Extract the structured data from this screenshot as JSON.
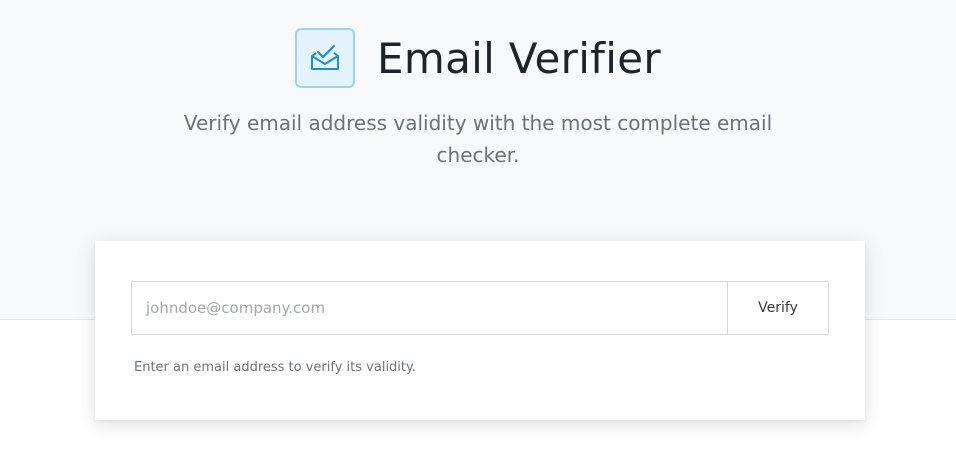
{
  "header": {
    "title": "Email Verifier",
    "subtitle": "Verify email address validity with the most complete email checker.",
    "icon": "envelope-check-icon"
  },
  "form": {
    "email_placeholder": "johndoe@company.com",
    "email_value": "",
    "verify_label": "Verify",
    "hint": "Enter an email address to verify its validity."
  },
  "colors": {
    "accent": "#1a8fd6",
    "icon_bg": "#e4f2fb",
    "hero_bg": "#f8f9fa"
  }
}
